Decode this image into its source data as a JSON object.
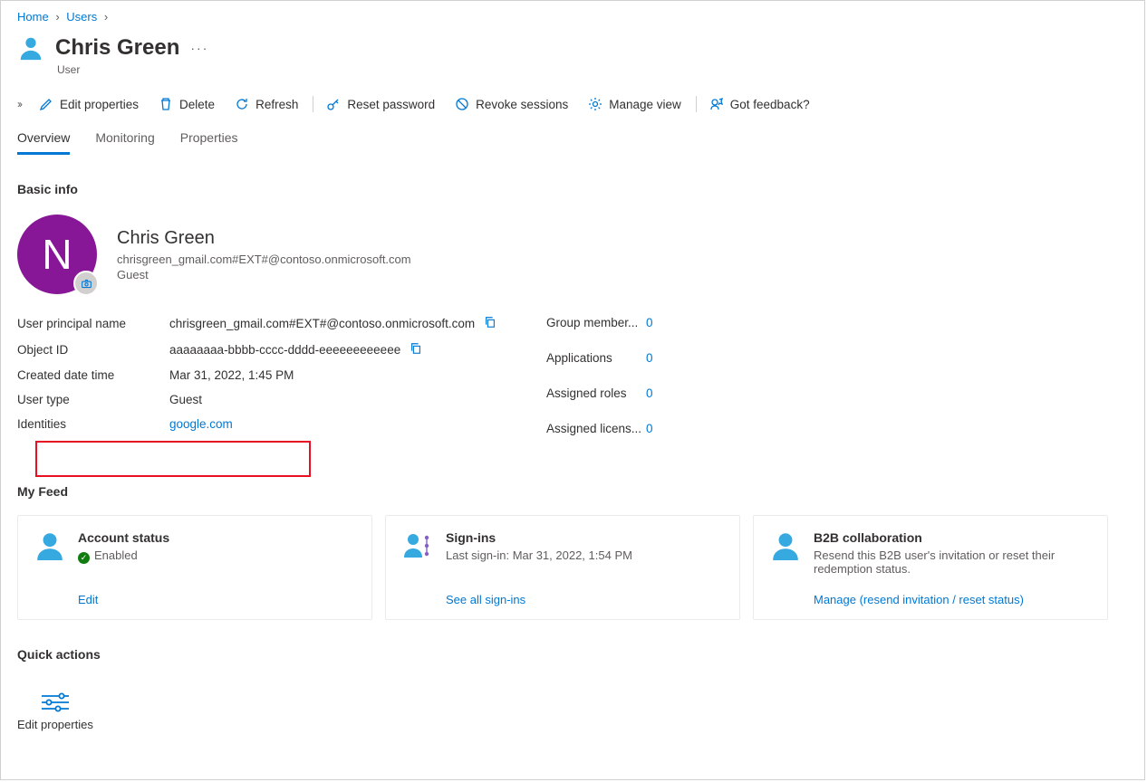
{
  "breadcrumb": {
    "home": "Home",
    "users": "Users"
  },
  "header": {
    "name": "Chris Green",
    "subtitle": "User"
  },
  "toolbar": {
    "edit_properties": "Edit properties",
    "delete": "Delete",
    "refresh": "Refresh",
    "reset_password": "Reset password",
    "revoke_sessions": "Revoke sessions",
    "manage_view": "Manage view",
    "got_feedback": "Got feedback?"
  },
  "tabs": {
    "overview": "Overview",
    "monitoring": "Monitoring",
    "properties": "Properties"
  },
  "sections": {
    "basic_info": "Basic info",
    "my_feed": "My Feed",
    "quick_actions": "Quick actions"
  },
  "profile": {
    "initial": "N",
    "name": "Chris Green",
    "upn": "chrisgreen_gmail.com#EXT#@contoso.onmicrosoft.com",
    "type": "Guest"
  },
  "info": {
    "upn_label": "User principal name",
    "upn_value": "chrisgreen_gmail.com#EXT#@contoso.onmicrosoft.com",
    "oid_label": "Object ID",
    "oid_value": "aaaaaaaa-bbbb-cccc-dddd-eeeeeeeeeeee",
    "created_label": "Created date time",
    "created_value": "Mar 31, 2022, 1:45 PM",
    "usertype_label": "User type",
    "usertype_value": "Guest",
    "identities_label": "Identities",
    "identities_value": "google.com"
  },
  "stats": {
    "group_label": "Group member...",
    "group_value": "0",
    "apps_label": "Applications",
    "apps_value": "0",
    "roles_label": "Assigned roles",
    "roles_value": "0",
    "lic_label": "Assigned licens...",
    "lic_value": "0"
  },
  "cards": {
    "account": {
      "title": "Account status",
      "status_text": "Enabled",
      "link": "Edit"
    },
    "signins": {
      "title": "Sign-ins",
      "sub": "Last sign-in: Mar 31, 2022, 1:54 PM",
      "link": "See all sign-ins"
    },
    "b2b": {
      "title": "B2B collaboration",
      "sub": "Resend this B2B user's invitation or reset their redemption status.",
      "link": "Manage (resend invitation / reset status)"
    }
  },
  "quick_actions": {
    "edit_properties": "Edit properties"
  }
}
